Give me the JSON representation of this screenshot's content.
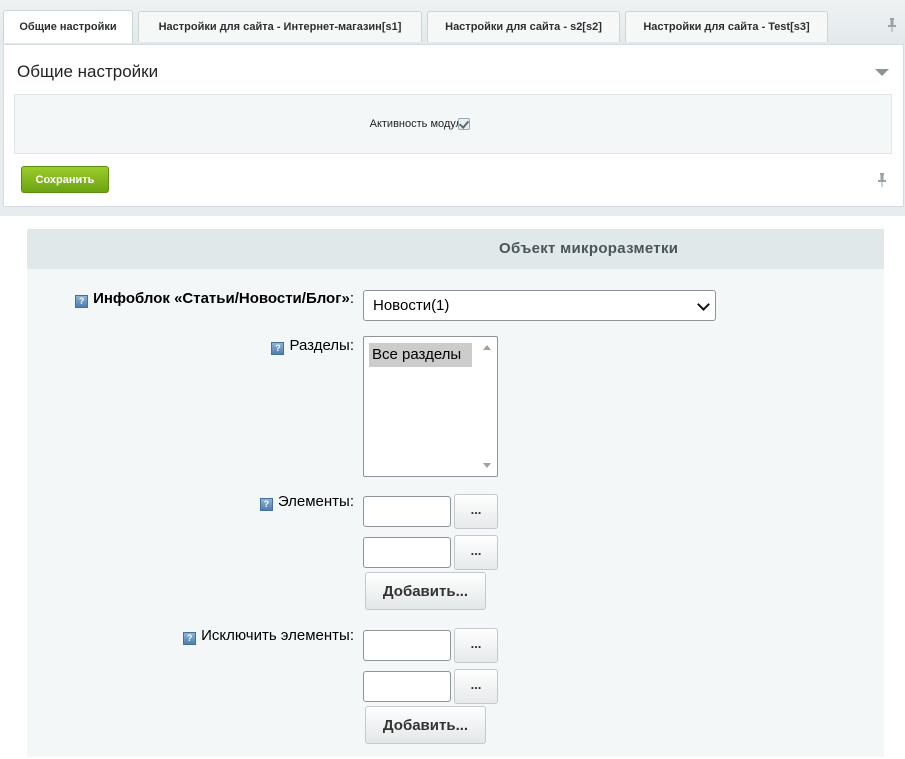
{
  "tabs": [
    {
      "label": "Общие настройки",
      "active": true
    },
    {
      "label": "Настройки для сайта - Интернет-магазин[s1]",
      "active": false
    },
    {
      "label": "Настройки для сайта - s2[s2]",
      "active": false
    },
    {
      "label": "Настройки для сайта - Test[s3]",
      "active": false
    }
  ],
  "panel": {
    "title": "Общие настройки",
    "module_active_label": "Активность модуля:",
    "module_active_checked": true,
    "save_label": "Сохранить"
  },
  "micro": {
    "title": "Объект микроразметки",
    "help_glyph": "?",
    "iblock_label": "Инфоблок «Статьи/Новости/Блог»",
    "iblock_value": "Новости(1)",
    "sections_label": "Разделы:",
    "sections_option": "Все разделы",
    "elements_label": "Элементы:",
    "exclude_label": "Исключить элементы:",
    "dots_label": "...",
    "add_label": "Добавить..."
  },
  "colors": {
    "save_button": "#7cb51c",
    "header_band": "#e0e8ea",
    "panel_bg": "#f4f7f8"
  }
}
